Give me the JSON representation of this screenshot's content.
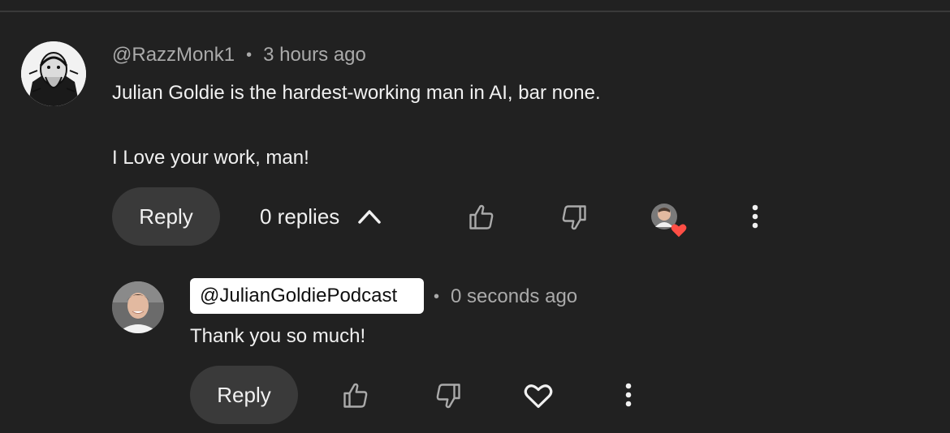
{
  "comment": {
    "author": "@RazzMonk1",
    "separator": "•",
    "time": "3 hours ago",
    "lines": [
      "Julian Goldie is the hardest-working man in AI, bar none.",
      "I Love your work, man!"
    ],
    "reply_label": "Reply",
    "replies_label": "0 replies",
    "icons": [
      "avatar-sketch",
      "thumb-up-icon",
      "thumb-down-icon",
      "creator-heart-icon",
      "more-vert-icon",
      "chevron-up-icon"
    ]
  },
  "reply": {
    "author": "@JulianGoldiePodcast",
    "separator": "•",
    "time": "0 seconds ago",
    "text": "Thank you so much!",
    "reply_label": "Reply",
    "icons": [
      "thumb-up-icon",
      "thumb-down-icon",
      "heart-icon",
      "more-vert-icon"
    ]
  },
  "colors": {
    "background": "#212121",
    "text": "#f1f1f1",
    "secondary_text": "#aaaaaa",
    "button": "#3a3a3a",
    "heart_badge": "#ff4e45",
    "chip": "#ffffff"
  }
}
